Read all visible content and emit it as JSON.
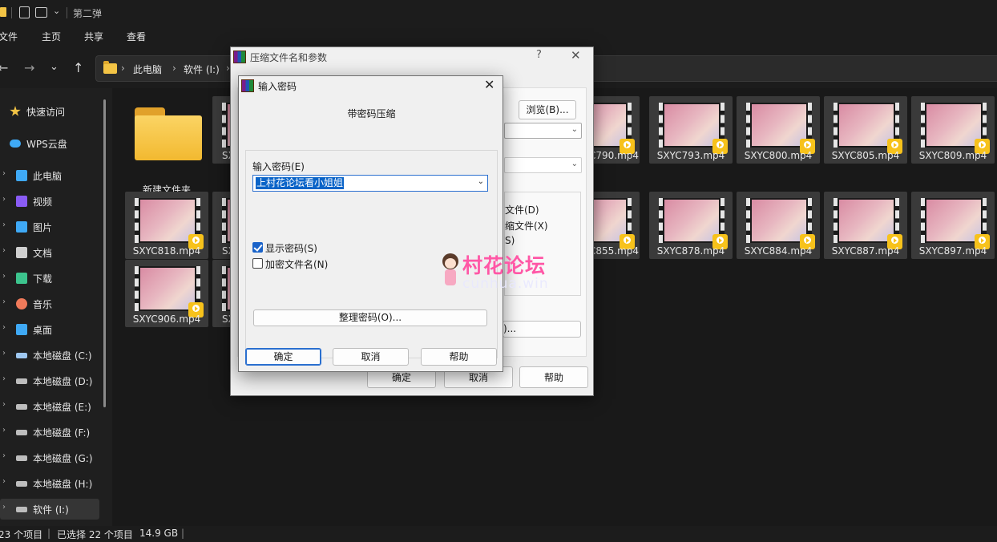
{
  "window": {
    "title": "第二弹"
  },
  "ribbon": {
    "tabs": [
      "文件",
      "主页",
      "共享",
      "查看"
    ]
  },
  "address": {
    "crumbs": [
      "此电脑",
      "软件 (I:)"
    ]
  },
  "sidebar": {
    "items": [
      {
        "label": "快速访问",
        "icon": "star-icon",
        "color": "#f3c445"
      },
      {
        "label": "WPS云盘",
        "icon": "cloud-icon",
        "color": "#3fa9f5"
      },
      {
        "label": "此电脑",
        "icon": "computer-icon",
        "color": "#3fa9f5"
      },
      {
        "label": "视频",
        "icon": "video-icon",
        "color": "#8a5cf5"
      },
      {
        "label": "图片",
        "icon": "picture-icon",
        "color": "#3fa9f5"
      },
      {
        "label": "文档",
        "icon": "document-icon",
        "color": "#cfcfcf"
      },
      {
        "label": "下载",
        "icon": "download-icon",
        "color": "#3cc48d"
      },
      {
        "label": "音乐",
        "icon": "music-icon",
        "color": "#f07a5a"
      },
      {
        "label": "桌面",
        "icon": "desktop-icon",
        "color": "#3fa9f5"
      },
      {
        "label": "本地磁盘 (C:)",
        "icon": "drive-c-icon",
        "color": "#9ec7f0"
      },
      {
        "label": "本地磁盘 (D:)",
        "icon": "drive-icon",
        "color": "#bdbdbd"
      },
      {
        "label": "本地磁盘 (E:)",
        "icon": "drive-icon",
        "color": "#bdbdbd"
      },
      {
        "label": "本地磁盘 (F:)",
        "icon": "drive-icon",
        "color": "#bdbdbd"
      },
      {
        "label": "本地磁盘 (G:)",
        "icon": "drive-icon",
        "color": "#bdbdbd"
      },
      {
        "label": "本地磁盘 (H:)",
        "icon": "drive-icon",
        "color": "#bdbdbd"
      },
      {
        "label": "软件 (I:)",
        "icon": "drive-icon",
        "color": "#bdbdbd"
      }
    ]
  },
  "files": {
    "folder": "新建文件夹",
    "row1": [
      "SX",
      "C790.mp4",
      "SXYC793.mp4",
      "SXYC800.mp4",
      "SXYC805.mp4",
      "SXYC809.mp4"
    ],
    "row2": [
      "SXYC818.mp4",
      "SX",
      "C855.mp4",
      "SXYC878.mp4",
      "SXYC884.mp4",
      "SXYC887.mp4",
      "SXYC897.mp4"
    ],
    "row3": [
      "SXYC906.mp4",
      "SX"
    ]
  },
  "status": {
    "count": "23 个项目",
    "selected": "已选择 22 个项目",
    "size": "14.9 GB"
  },
  "archive_dialog": {
    "title": "压缩文件名和参数",
    "help": "?",
    "browse": "浏览(B)...",
    "opt1": "文件(D)",
    "opt2": "缩文件(X)",
    "opt3": "S)",
    "btn_partial": ")...",
    "ok": "确定",
    "cancel": "取消",
    "help_btn": "帮助"
  },
  "password_dialog": {
    "title": "输入密码",
    "subtitle": "带密码压缩",
    "field_label": "输入密码(E)",
    "password_value": "上村花论坛看小姐姐",
    "show_password": "显示密码(S)",
    "show_password_checked": true,
    "encrypt_names": "加密文件名(N)",
    "encrypt_names_checked": false,
    "organize": "整理密码(O)...",
    "ok": "确定",
    "cancel": "取消",
    "help": "帮助"
  },
  "watermark": {
    "brand": "村花论坛",
    "url": "cunhua.win"
  }
}
